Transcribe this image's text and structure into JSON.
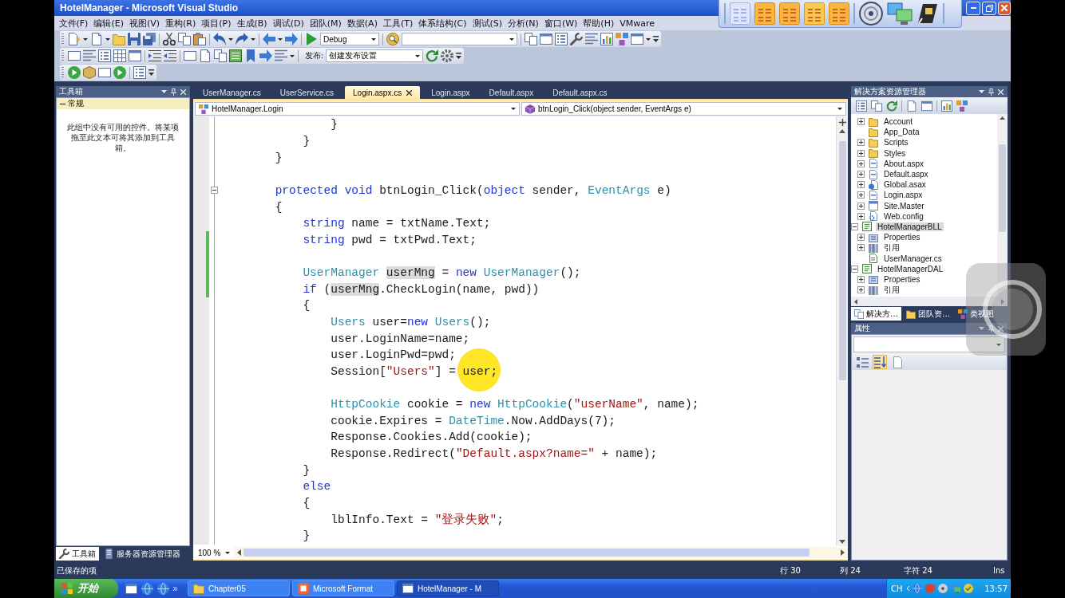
{
  "window": {
    "title": "HotelManager - Microsoft Visual Studio"
  },
  "menu": [
    "文件(F)",
    "编辑(E)",
    "视图(V)",
    "重构(R)",
    "项目(P)",
    "生成(B)",
    "调试(D)",
    "团队(M)",
    "数据(A)",
    "工具(T)",
    "体系结构(C)",
    "测试(S)",
    "分析(N)",
    "窗口(W)",
    "帮助(H)",
    "VMware"
  ],
  "toolbar": {
    "configuration": "Debug",
    "publish_label": "发布:",
    "publish_profile": "创建发布设置"
  },
  "toolbox": {
    "title": "工具箱",
    "group": {
      "label": "常规",
      "expanded": true
    },
    "empty_text": "此组中没有可用的控件。将某项拖至此文本可将其添加到工具箱。",
    "tabs": [
      {
        "label": "工具箱",
        "selected": true
      },
      {
        "label": "服务器资源管理器",
        "selected": false
      }
    ]
  },
  "editor": {
    "tabs": [
      {
        "label": "UserManager.cs",
        "selected": false
      },
      {
        "label": "UserService.cs",
        "selected": false
      },
      {
        "label": "Login.aspx.cs",
        "selected": true
      },
      {
        "label": "Login.aspx",
        "selected": false
      },
      {
        "label": "Default.aspx",
        "selected": false
      },
      {
        "label": "Default.aspx.cs",
        "selected": false
      }
    ],
    "type_dropdown": "HotelManager.Login",
    "member_dropdown": "btnLogin_Click(object sender, EventArgs e)",
    "lines": [
      {
        "tokens": [
          {
            "kind": "plain",
            "text": "                }"
          }
        ],
        "changed": false
      },
      {
        "tokens": [
          {
            "kind": "plain",
            "text": "            }"
          }
        ],
        "changed": false
      },
      {
        "tokens": [
          {
            "kind": "plain",
            "text": "        }"
          }
        ],
        "changed": false
      },
      {
        "changed": false
      },
      {
        "tokens": [
          {
            "kind": "keyword",
            "text": "        protected void"
          },
          {
            "kind": "plain",
            "text": " btnLogin_Click("
          },
          {
            "kind": "keyword",
            "text": "object"
          },
          {
            "kind": "plain",
            "text": " sender, "
          },
          {
            "kind": "type",
            "text": "EventArgs"
          },
          {
            "kind": "plain",
            "text": " e)"
          }
        ],
        "changed": false,
        "expanded": true
      },
      {
        "tokens": [
          {
            "kind": "plain",
            "text": "        {"
          }
        ],
        "changed": false
      },
      {
        "tokens": [
          {
            "kind": "keyword",
            "text": "            string"
          },
          {
            "kind": "plain",
            "text": " name = txtName.Text;"
          }
        ],
        "changed": false
      },
      {
        "tokens": [
          {
            "kind": "keyword",
            "text": "            string"
          },
          {
            "kind": "plain",
            "text": " pwd = txtPwd.Text;"
          }
        ],
        "changed": true
      },
      {
        "changed": true
      },
      {
        "tokens": [
          {
            "kind": "type",
            "text": "            UserManager "
          },
          {
            "kind": "ref",
            "text": "userMng"
          },
          {
            "kind": "plain",
            "text": " = "
          },
          {
            "kind": "keyword",
            "text": "new "
          },
          {
            "kind": "type",
            "text": "UserManager"
          },
          {
            "kind": "plain",
            "text": "();"
          }
        ],
        "changed": true
      },
      {
        "tokens": [
          {
            "kind": "keyword",
            "text": "            if"
          },
          {
            "kind": "plain",
            "text": " ("
          },
          {
            "kind": "ref",
            "text": "userMng"
          },
          {
            "kind": "plain",
            "text": ".CheckLogin(name, pwd))"
          }
        ],
        "changed": true
      },
      {
        "tokens": [
          {
            "kind": "plain",
            "text": "            {"
          }
        ],
        "changed": false
      },
      {
        "tokens": [
          {
            "kind": "type",
            "text": "                Users"
          },
          {
            "kind": "plain",
            "text": " user="
          },
          {
            "kind": "keyword",
            "text": "new "
          },
          {
            "kind": "type",
            "text": "Users"
          },
          {
            "kind": "plain",
            "text": "();"
          }
        ],
        "changed": false
      },
      {
        "tokens": [
          {
            "kind": "plain",
            "text": "                user.LoginName=name;"
          }
        ],
        "changed": false
      },
      {
        "tokens": [
          {
            "kind": "plain",
            "text": "                user.LoginPwd=pwd;"
          }
        ],
        "changed": false
      },
      {
        "tokens": [
          {
            "kind": "plain",
            "text": "                Session["
          },
          {
            "kind": "string",
            "text": "\"Users\""
          },
          {
            "kind": "plain",
            "text": "] = user;"
          }
        ],
        "changed": false
      },
      {
        "changed": false
      },
      {
        "tokens": [
          {
            "kind": "type",
            "text": "                HttpCookie"
          },
          {
            "kind": "plain",
            "text": " cookie = "
          },
          {
            "kind": "keyword",
            "text": "new "
          },
          {
            "kind": "type",
            "text": "HttpCookie"
          },
          {
            "kind": "plain",
            "text": "("
          },
          {
            "kind": "string",
            "text": "\"userName\""
          },
          {
            "kind": "plain",
            "text": ", name);"
          }
        ],
        "changed": false
      },
      {
        "tokens": [
          {
            "kind": "plain",
            "text": "                cookie.Expires = "
          },
          {
            "kind": "type",
            "text": "DateTime"
          },
          {
            "kind": "plain",
            "text": ".Now.AddDays(7);"
          }
        ],
        "changed": false
      },
      {
        "tokens": [
          {
            "kind": "plain",
            "text": "                Response.Cookies.Add(cookie);"
          }
        ],
        "changed": false
      },
      {
        "tokens": [
          {
            "kind": "plain",
            "text": "                Response.Redirect("
          },
          {
            "kind": "string",
            "text": "\"Default.aspx?name=\""
          },
          {
            "kind": "plain",
            "text": " + name);"
          }
        ],
        "changed": false
      },
      {
        "tokens": [
          {
            "kind": "plain",
            "text": "            }"
          }
        ],
        "changed": false
      },
      {
        "tokens": [
          {
            "kind": "keyword",
            "text": "            else"
          }
        ],
        "changed": false
      },
      {
        "tokens": [
          {
            "kind": "plain",
            "text": "            {"
          }
        ],
        "changed": false
      },
      {
        "tokens": [
          {
            "kind": "plain",
            "text": "                lblInfo.Text = "
          },
          {
            "kind": "string",
            "text": "\"登录失败\""
          },
          {
            "kind": "plain",
            "text": ";"
          }
        ],
        "changed": false
      },
      {
        "tokens": [
          {
            "kind": "plain",
            "text": "            }"
          }
        ],
        "changed": false
      }
    ],
    "zoom": "100 %"
  },
  "solution_explorer": {
    "title": "解决方案资源管理器",
    "tree": [
      {
        "children": [
          {
            "label": "Account",
            "kind": "folder",
            "expanded": false,
            "selected": false
          },
          {
            "label": "App_Data",
            "kind": "folder",
            "selected": false
          },
          {
            "label": "Scripts",
            "kind": "folder",
            "expanded": false,
            "selected": false
          },
          {
            "label": "Styles",
            "kind": "folder",
            "expanded": false,
            "selected": false
          },
          {
            "label": "About.aspx",
            "kind": "page",
            "expanded": false,
            "selected": false
          },
          {
            "label": "Default.aspx",
            "kind": "page",
            "expanded": false,
            "selected": false
          },
          {
            "label": "Global.asax",
            "kind": "global",
            "expanded": false,
            "selected": false
          },
          {
            "label": "Login.aspx",
            "kind": "page",
            "expanded": false,
            "selected": false
          },
          {
            "label": "Site.Master",
            "kind": "master",
            "expanded": false,
            "selected": false
          },
          {
            "label": "Web.config",
            "kind": "config",
            "expanded": false,
            "selected": false
          }
        ]
      },
      {
        "label": "HotelManagerBLL",
        "kind": "project",
        "expanded": true,
        "selected": true,
        "children": [
          {
            "label": "Properties",
            "kind": "properties",
            "expanded": false,
            "selected": false
          },
          {
            "label": "引用",
            "kind": "references",
            "expanded": false,
            "selected": false
          },
          {
            "label": "UserManager.cs",
            "kind": "code",
            "selected": false
          }
        ]
      },
      {
        "label": "HotelManagerDAL",
        "kind": "project",
        "expanded": true,
        "selected": false,
        "children": [
          {
            "label": "Properties",
            "kind": "properties",
            "expanded": false,
            "selected": false
          },
          {
            "label": "引用",
            "kind": "references",
            "expanded": false,
            "selected": false
          }
        ]
      }
    ],
    "tabs": [
      {
        "label": "解决方…",
        "selected": true
      },
      {
        "label": "团队资…",
        "selected": false
      },
      {
        "label": "类视图",
        "selected": false
      }
    ]
  },
  "properties": {
    "title": "属性",
    "toolbar_buttons": [
      {
        "kind": "categorized",
        "selected": false
      },
      {
        "kind": "alphabetical",
        "selected": true
      },
      {
        "kind": "pages",
        "selected": false
      }
    ]
  },
  "status_bar": {
    "message": "已保存的项",
    "line": "行 30",
    "column": "列 24",
    "char": "字符 24",
    "mode": "Ins"
  },
  "taskbar": {
    "start": "开始",
    "buttons": [
      {
        "label": "Chapter05",
        "kind": "folder",
        "selected": false
      },
      {
        "label": "Microsoft Format",
        "kind": "app",
        "selected": false
      },
      {
        "label": "HotelManager - M",
        "kind": "studio",
        "selected": true
      }
    ],
    "language": "CH",
    "clock": "13:57"
  }
}
